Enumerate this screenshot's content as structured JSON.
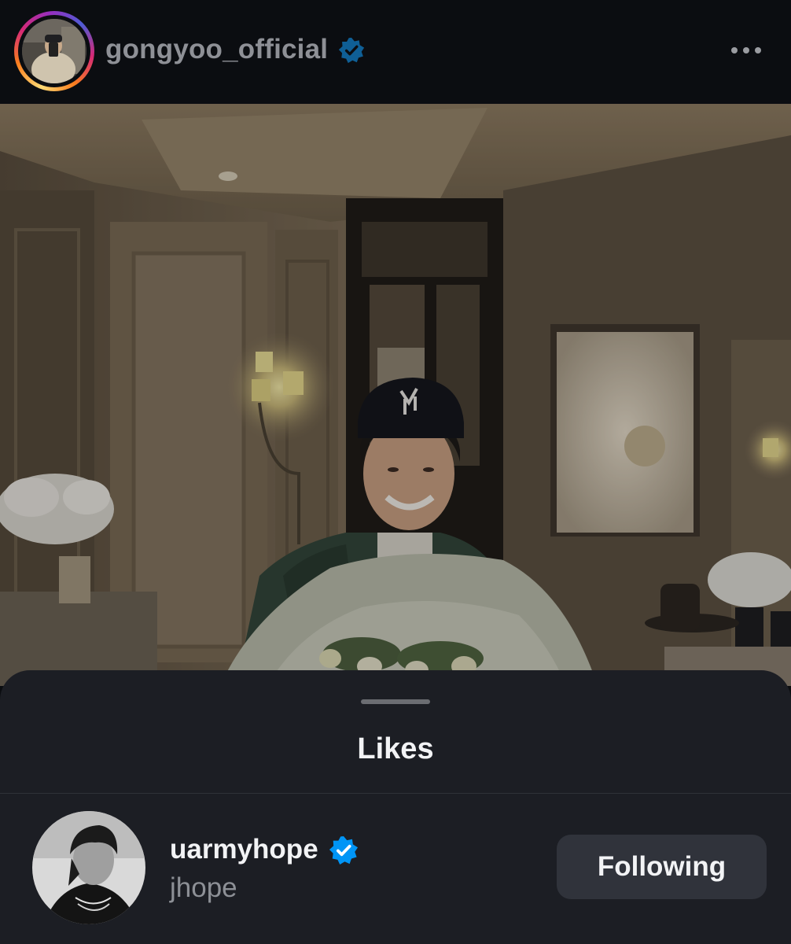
{
  "post": {
    "author_username": "gongyoo_official",
    "author_verified": true
  },
  "likes_sheet": {
    "title": "Likes",
    "likers": [
      {
        "username": "uarmyhope",
        "full_name": "jhope",
        "verified": true,
        "follow_status": "Following"
      }
    ]
  },
  "colors": {
    "verified_badge": "#0095f6",
    "sheet_background": "#1c1e24",
    "button_background": "#30333b"
  },
  "icons": {
    "verified": "verified-badge-icon",
    "more": "more-options-icon"
  }
}
